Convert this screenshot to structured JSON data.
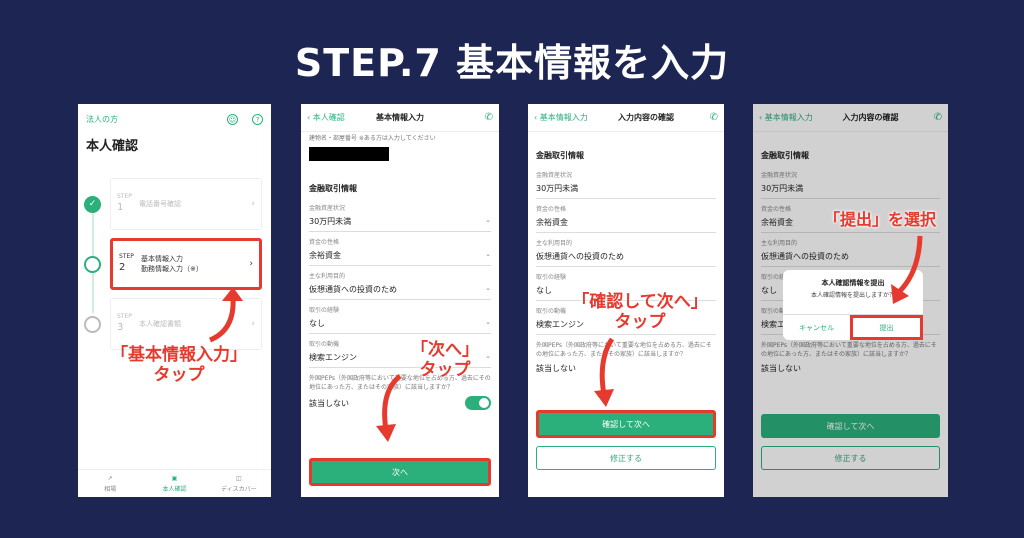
{
  "title": "STEP.7 基本情報を入力",
  "colors": {
    "background": "#1d2652",
    "accent": "#2bb07c",
    "highlight": "#e63a2e"
  },
  "phone1": {
    "corp_link": "法人の方",
    "heading": "本人確認",
    "steps": [
      {
        "step_label": "STEP",
        "num": "1",
        "label": "電話番号確認",
        "state": "done"
      },
      {
        "step_label": "STEP",
        "num": "2",
        "label": "基本情報入力",
        "label2": "勤務情報入力（※）",
        "state": "active"
      },
      {
        "step_label": "STEP",
        "num": "3",
        "label": "本人確認書類",
        "state": "todo"
      }
    ],
    "nav": [
      "相場",
      "本人確認",
      "ディスカバー"
    ]
  },
  "phone2": {
    "back": "本人確認",
    "title": "基本情報入力",
    "note": "建物名・部屋番号 ※ある方は入力してください",
    "section": "金融取引情報",
    "fields": [
      {
        "label": "金融資産状況",
        "value": "30万円未満"
      },
      {
        "label": "資金の性格",
        "value": "余裕資金"
      },
      {
        "label": "主な利用目的",
        "value": "仮想通貨への投資のため"
      },
      {
        "label": "取引の経験",
        "value": "なし"
      },
      {
        "label": "取引の動機",
        "value": "検索エンジン"
      }
    ],
    "peps_text": "外国PEPs（外国政府等において重要な地位を占める方、過去にその地位にあった方、またはその家族）に該当しますか？",
    "peps_value": "該当しない",
    "next_button": "次へ"
  },
  "phone3": {
    "back": "基本情報入力",
    "title": "入力内容の確認",
    "section": "金融取引情報",
    "fields": [
      {
        "label": "金融資産状況",
        "value": "30万円未満"
      },
      {
        "label": "資金の性格",
        "value": "余裕資金"
      },
      {
        "label": "主な利用目的",
        "value": "仮想通貨への投資のため"
      },
      {
        "label": "取引の経験",
        "value": "なし"
      },
      {
        "label": "取引の動機",
        "value": "検索エンジン"
      }
    ],
    "peps_text": "外国PEPs（外国政府等において重要な地位を占める方、過去にその地位にあった方、またはその家族）に該当しますか？",
    "peps_value": "該当しない",
    "confirm_button": "確認して次へ",
    "edit_button": "修正する"
  },
  "phone4": {
    "back": "基本情報入力",
    "title": "入力内容の確認",
    "section": "金融取引情報",
    "fields": [
      {
        "label": "金融資産状況",
        "value": "30万円未満"
      },
      {
        "label": "資金の性格",
        "value": "余裕資金"
      },
      {
        "label": "主な利用目的",
        "value": "仮想通貨への投資のため"
      },
      {
        "label": "取引の経験",
        "value": "なし"
      },
      {
        "label": "取引の動機",
        "value": "検索エンジン"
      }
    ],
    "peps_text": "外国PEPs（外国政府等において重要な地位を占める方、過去にその地位にあった方、またはその家族）に該当しますか？",
    "peps_value": "該当しない",
    "confirm_button": "確認して次へ",
    "edit_button": "修正する",
    "dialog": {
      "title": "本人確認情報を提出",
      "message": "本人確認情報を提出しますか？",
      "cancel": "キャンセル",
      "submit": "提出"
    }
  },
  "annotations": {
    "a1_line1": "「基本情報入力」",
    "a1_line2": "タップ",
    "a2_line1": "「次へ」",
    "a2_line2": "タップ",
    "a3_line1": "「確認して次へ」",
    "a3_line2": "タップ",
    "a4_line1": "「提出」を選択"
  }
}
